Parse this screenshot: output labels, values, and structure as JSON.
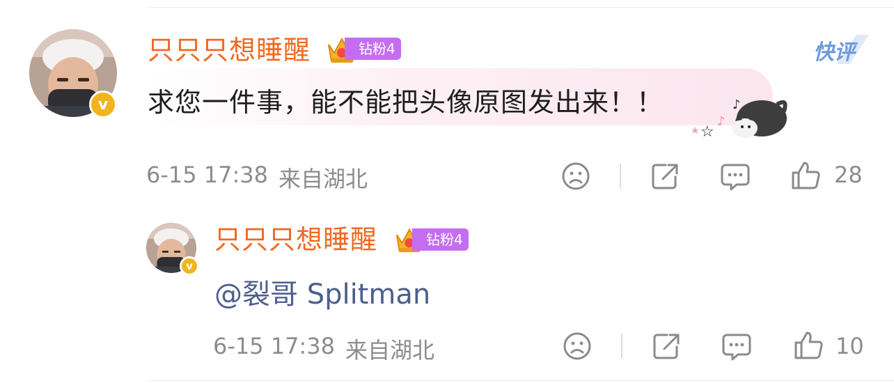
{
  "comment": {
    "username": "只只只想睡醒",
    "fan_badge": "钻粉4",
    "text": "求您一件事，能不能把头像原图发出来！！",
    "time": "6-15 17:38",
    "location": "来自湖北",
    "likes": "28",
    "quick_comment": "快评"
  },
  "reply": {
    "username": "只只只想睡醒",
    "fan_badge": "钻粉4",
    "mention": "@裂哥 Splitman",
    "time": "6-15 17:38",
    "location": "来自湖北",
    "likes": "10"
  },
  "colors": {
    "username": "#ef6a22",
    "mention": "#4c5e8c",
    "fan_badge": "#c56df0",
    "meta": "#8c8c8c",
    "verified": "#f2b41c"
  },
  "icons": [
    "avatar",
    "verified-badge-icon",
    "crown-icon",
    "sad-face-icon",
    "share-icon",
    "comment-icon",
    "thumbs-up-icon",
    "cat-sticker-icon"
  ]
}
